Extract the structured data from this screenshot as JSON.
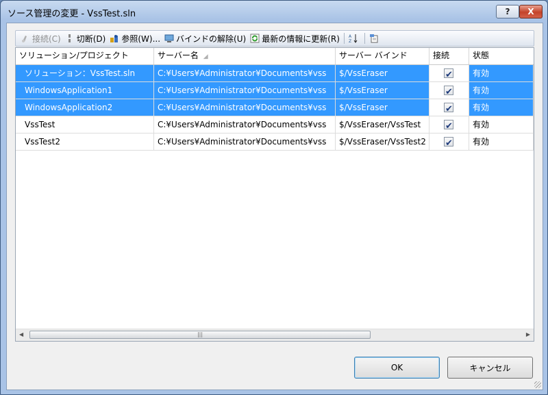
{
  "window": {
    "title": "ソース管理の変更 - VssTest.sln",
    "help_label": "?",
    "close_label": "X"
  },
  "toolbar": {
    "connect_label": "接続(C)",
    "disconnect_label": "切断(D)",
    "browse_label": "参照(W)...",
    "unbind_label": "バインドの解除(U)",
    "refresh_label": "最新の情報に更新(R)"
  },
  "columns": {
    "solution_project": "ソリューション/プロジェクト",
    "server_name": "サーバー名",
    "server_binding": "サーバー バインド",
    "connected": "接続",
    "status": "状態"
  },
  "rows": [
    {
      "name": "ソリューション：VssTest.sln",
      "server": "C:¥Users¥Administrator¥Documents¥vss",
      "binding": "$/VssEraser",
      "connected": true,
      "status": "有効",
      "selected": true
    },
    {
      "name": "WindowsApplication1",
      "server": "C:¥Users¥Administrator¥Documents¥vss",
      "binding": "$/VssEraser",
      "connected": true,
      "status": "有効",
      "selected": true
    },
    {
      "name": "WindowsApplication2",
      "server": "C:¥Users¥Administrator¥Documents¥vss",
      "binding": "$/VssEraser",
      "connected": true,
      "status": "有効",
      "selected": true
    },
    {
      "name": "VssTest",
      "server": "C:¥Users¥Administrator¥Documents¥vss",
      "binding": "$/VssEraser/VssTest",
      "connected": true,
      "status": "有効",
      "selected": false
    },
    {
      "name": "VssTest2",
      "server": "C:¥Users¥Administrator¥Documents¥vss",
      "binding": "$/VssEraser/VssTest2",
      "connected": true,
      "status": "有効",
      "selected": false
    }
  ],
  "buttons": {
    "ok": "OK",
    "cancel": "キャンセル"
  },
  "colors": {
    "selection": "#3399ff",
    "title_bar": "#a9c3e6"
  },
  "icons": [
    "connect-icon",
    "disconnect-icon",
    "browse-icon",
    "unbind-icon",
    "refresh-icon",
    "sort-icon",
    "properties-icon"
  ]
}
